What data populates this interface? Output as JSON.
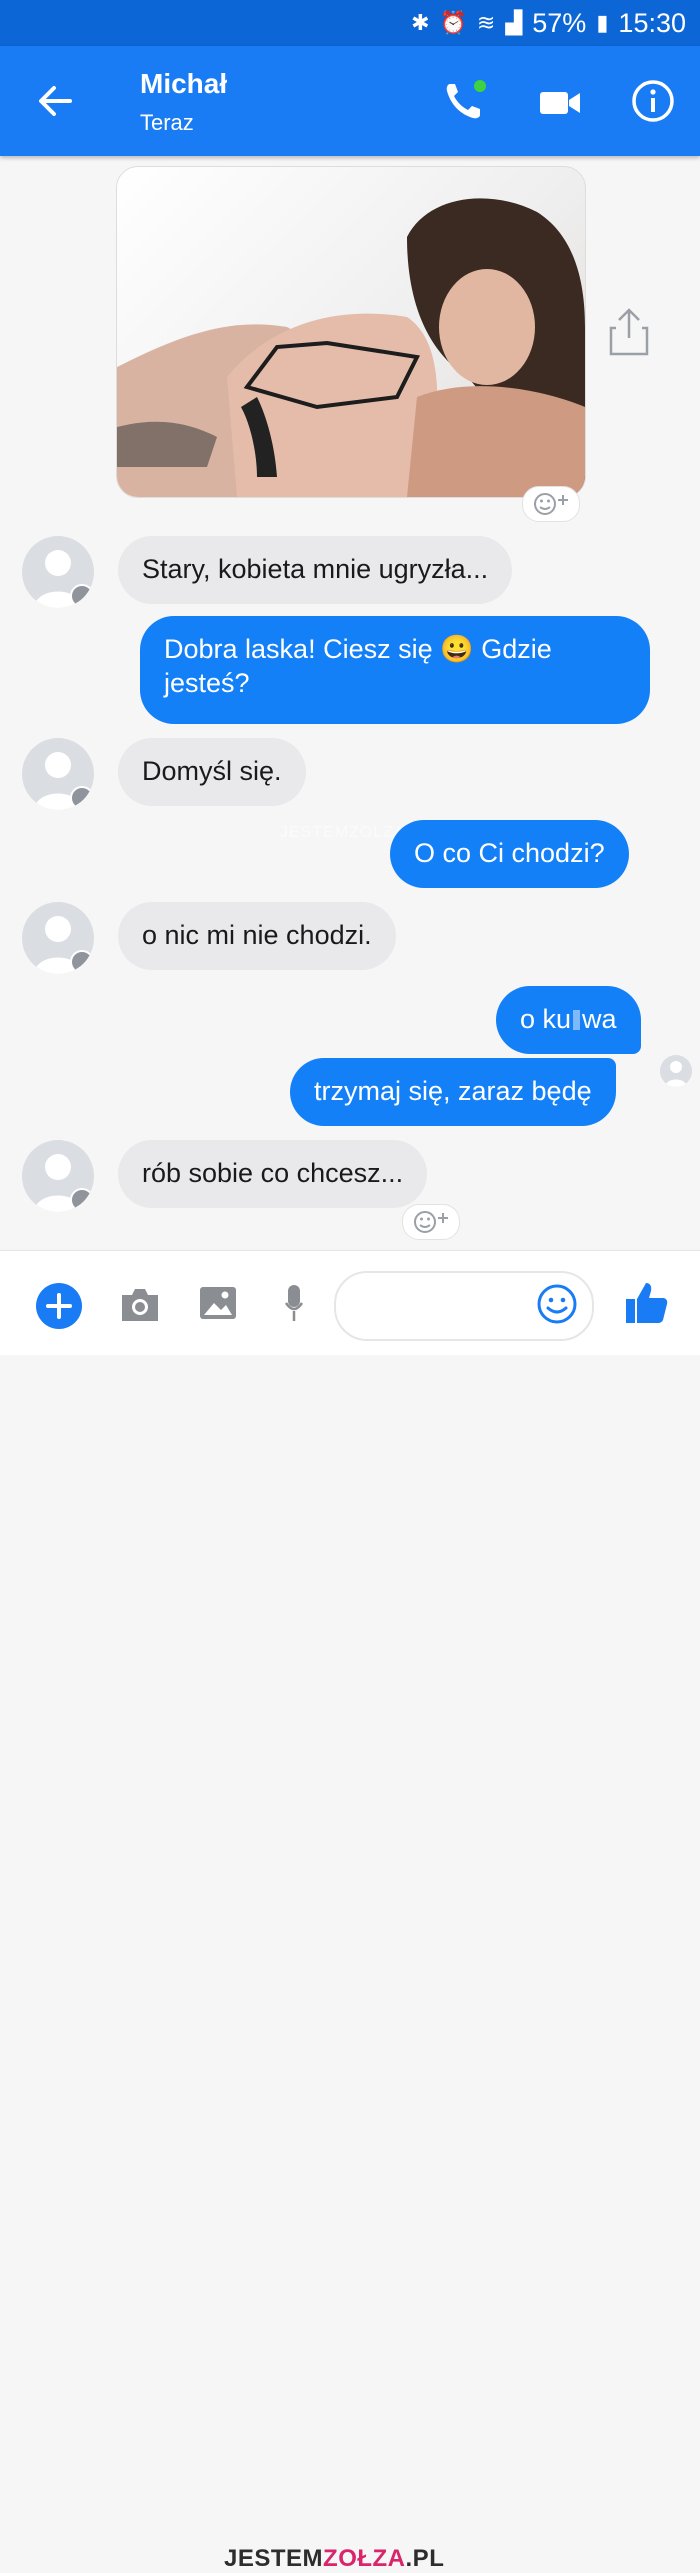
{
  "status_bar": {
    "icons": [
      "bluetooth-icon",
      "alarm-icon",
      "wifi-icon",
      "signal-icon",
      "battery-icon"
    ],
    "battery": "57%",
    "time": "15:30"
  },
  "header": {
    "contact_name": "Michał",
    "contact_status": "Teraz",
    "actions": [
      "back-icon",
      "phone-icon",
      "video-icon",
      "info-icon"
    ]
  },
  "messages": [
    {
      "from": "them",
      "text": "Stary, kobieta mnie ugryzła..."
    },
    {
      "from": "me",
      "line1": "Dobra laska! Ciesz się 😀 Gdzie",
      "line2": "jesteś?"
    },
    {
      "from": "them",
      "text": "Domyśl się."
    },
    {
      "from": "me",
      "text": "O co Ci chodzi?"
    },
    {
      "from": "them",
      "text": "o nic mi nie chodzi."
    },
    {
      "from": "me",
      "text": "o ku",
      "text_end": "wa"
    },
    {
      "from": "me",
      "text": "trzymaj się, zaraz będę"
    },
    {
      "from": "them",
      "text": "rób sobie co chcesz..."
    }
  ],
  "watermark": {
    "small": "JESTEMZOLZA.PL",
    "big_part1": "JESTEM",
    "big_part2": "ZOŁZA",
    "big_part3": ".PL"
  },
  "composer": {
    "icons": [
      "plus-icon",
      "camera-icon",
      "image-icon",
      "mic-icon",
      "emoji-icon",
      "thumbs-up-icon"
    ]
  },
  "colors": {
    "status_bar": "#0c66d6",
    "header": "#1a7cf5",
    "outgoing_bubble": "#1480f8",
    "incoming_bubble": "#e9e9eb"
  }
}
